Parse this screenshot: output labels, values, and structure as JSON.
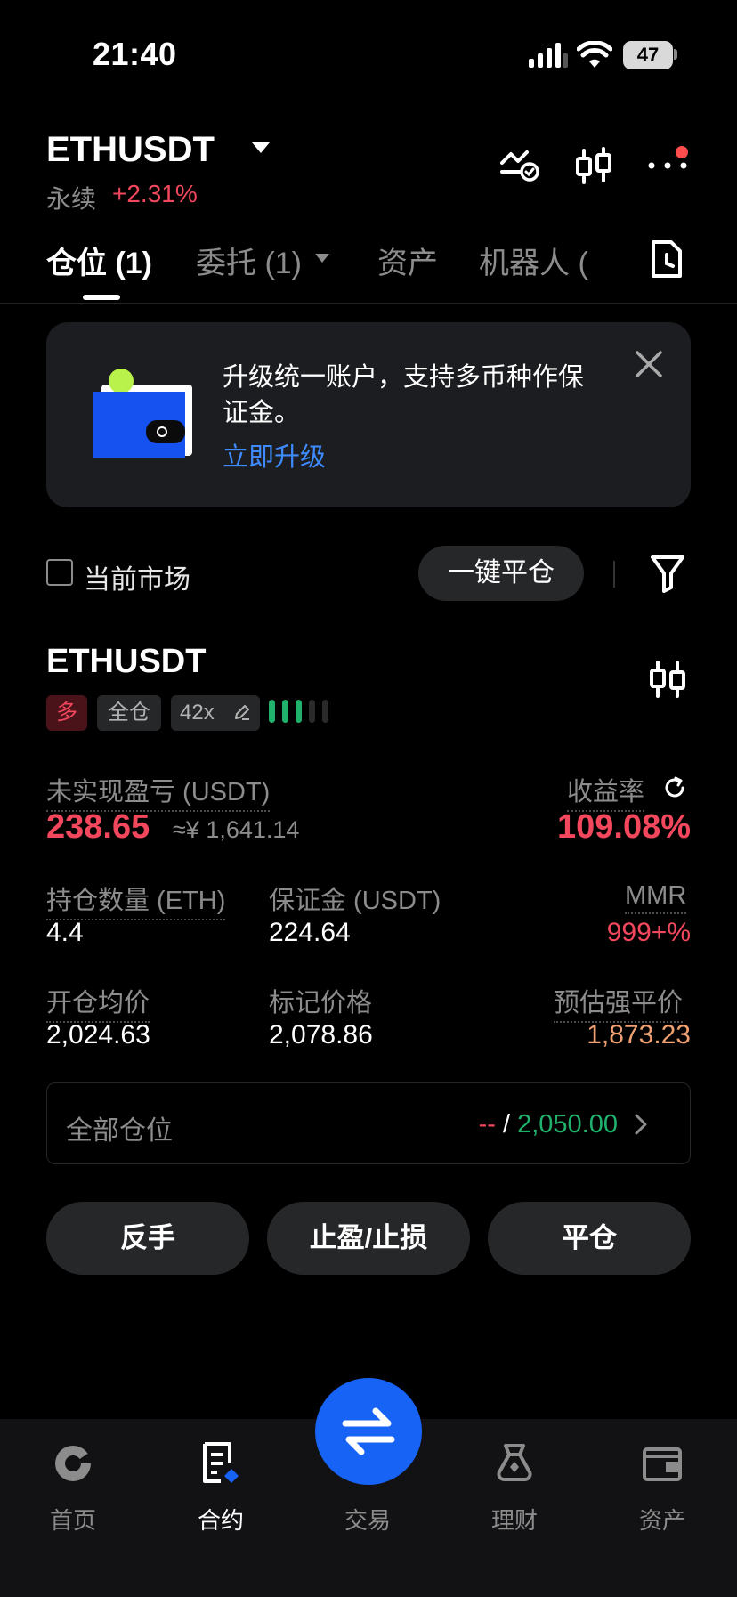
{
  "status_bar": {
    "time": "21:40",
    "battery": "47"
  },
  "header": {
    "symbol": "ETHUSDT",
    "contract_type": "永续",
    "change": "+2.31%",
    "notification_dot_color": "#ff4d4d"
  },
  "tabs": [
    {
      "label": "仓位 (1)",
      "active": true
    },
    {
      "label": "委托 (1)",
      "active": false,
      "has_dropdown": true
    },
    {
      "label": "资产",
      "active": false
    },
    {
      "label": "机器人 (",
      "active": false
    }
  ],
  "banner": {
    "text": "升级统一账户，支持多币种作保证金。",
    "link": "立即升级"
  },
  "filter": {
    "current_market_label": "当前市场",
    "current_market_checked": false,
    "close_all_label": "一键平仓"
  },
  "position": {
    "symbol": "ETHUSDT",
    "side_tag": "多",
    "margin_mode_tag": "全仓",
    "leverage_tag": "42x",
    "risk_level": "3 of 5",
    "unrealized_pnl_label": "未实现盈亏 (USDT)",
    "unrealized_pnl": "238.65",
    "unrealized_pnl_cny": "≈¥ 1,641.14",
    "roe_label": "收益率",
    "roe": "109.08%",
    "size_label": "持仓数量 (ETH)",
    "size": "4.4",
    "margin_label": "保证金 (USDT)",
    "margin": "224.64",
    "mmr_label": "MMR",
    "mmr": "999+%",
    "entry_label": "开仓均价",
    "entry": "2,024.63",
    "mark_label": "标记价格",
    "mark": "2,078.86",
    "liq_label": "预估强平价",
    "liq": "1,873.23",
    "all_positions_label": "全部仓位",
    "all_positions_tp": "--",
    "all_positions_sep": "/",
    "all_positions_sl": "2,050.00"
  },
  "actions": {
    "reverse": "反手",
    "tpsl": "止盈/止损",
    "close": "平仓"
  },
  "bottom_nav": [
    {
      "label": "首页",
      "icon": "home-icon",
      "active": false
    },
    {
      "label": "合约",
      "icon": "futures-icon",
      "active": true
    },
    {
      "label": "交易",
      "icon": "trade-swap-icon",
      "active": false
    },
    {
      "label": "理财",
      "icon": "earn-icon",
      "active": false
    },
    {
      "label": "资产",
      "icon": "wallet-icon",
      "active": false
    }
  ],
  "colors": {
    "accent_blue": "#1763f5",
    "link_blue": "#3d8bff",
    "negative_red": "#f2475c",
    "positive_green": "#20b26c",
    "liquidation_orange": "#f0a070"
  }
}
